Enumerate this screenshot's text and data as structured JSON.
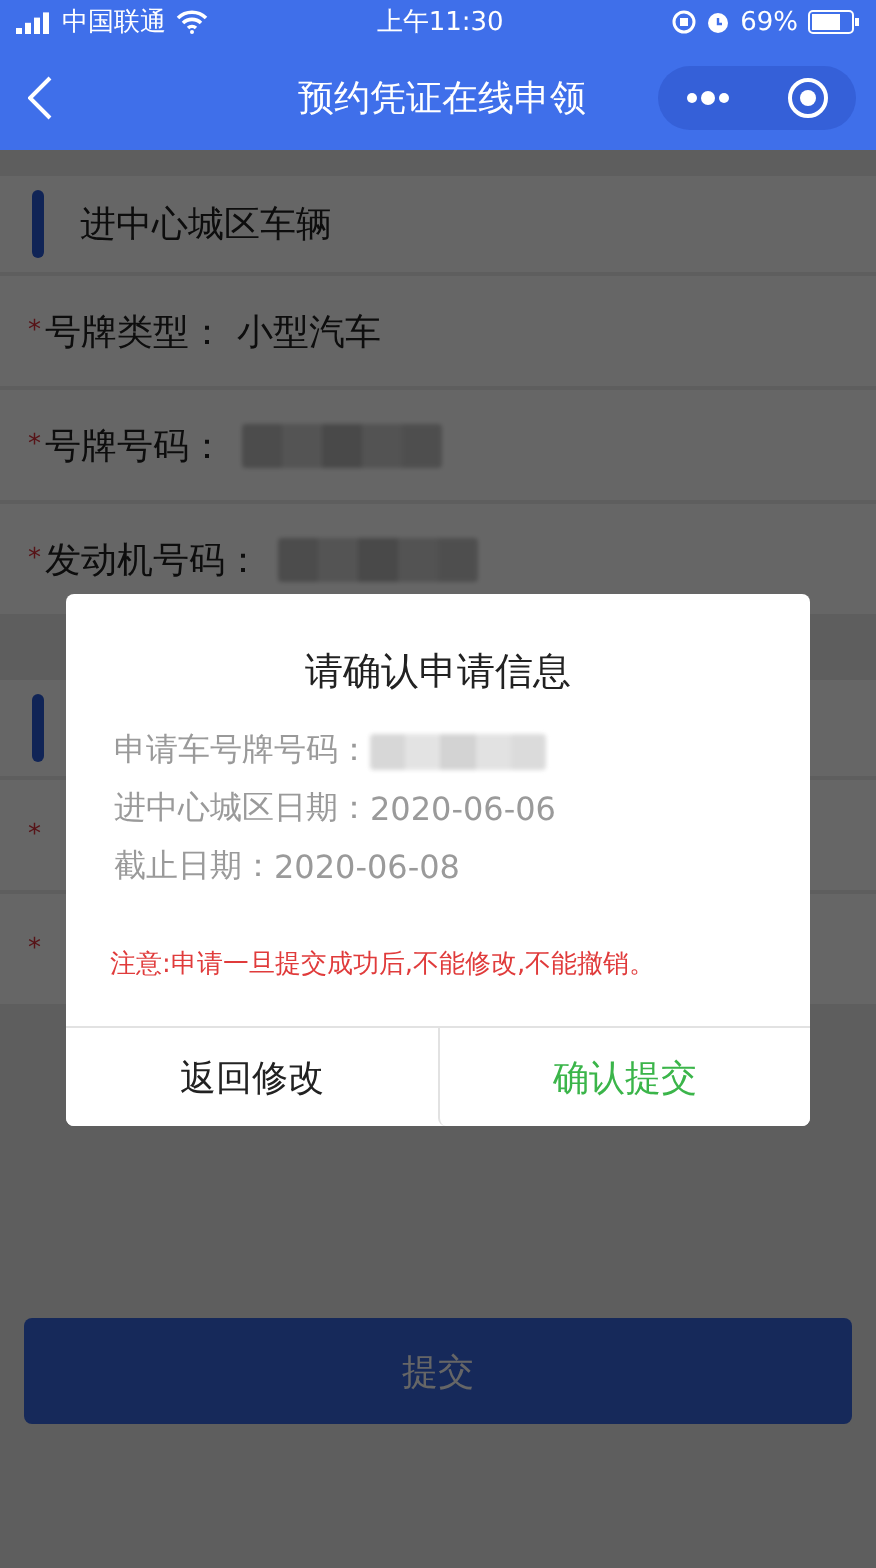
{
  "status_bar": {
    "carrier": "中国联通",
    "time": "上午11:30",
    "battery": "69%"
  },
  "nav_bar": {
    "title": "预约凭证在线申领"
  },
  "sections": [
    {
      "title": "进中心城区车辆",
      "fields": [
        {
          "required_mark": "*",
          "label": "号牌类型：",
          "value": "小型汽车"
        },
        {
          "required_mark": "*",
          "label": "号牌号码：",
          "redacted": true
        },
        {
          "required_mark": "*",
          "label": "发动机号码：",
          "redacted": true
        }
      ]
    },
    {
      "fields": [
        {
          "required_mark": "*"
        },
        {
          "required_mark": "*"
        }
      ]
    }
  ],
  "submit_button": {
    "label": "提交"
  },
  "dialog": {
    "open": true,
    "title": "请确认申请信息",
    "rows": [
      {
        "label": "申请车号牌号码：",
        "redacted": true
      },
      {
        "label": "进中心城区日期：",
        "value": "2020-06-06"
      },
      {
        "label": "截止日期：",
        "value": "2020-06-08"
      }
    ],
    "notice": "注意:申请一旦提交成功后,不能修改,不能撤销。",
    "buttons": [
      {
        "label": "返回修改",
        "kind": "cancel"
      },
      {
        "label": "确认提交",
        "kind": "confirm"
      }
    ]
  }
}
